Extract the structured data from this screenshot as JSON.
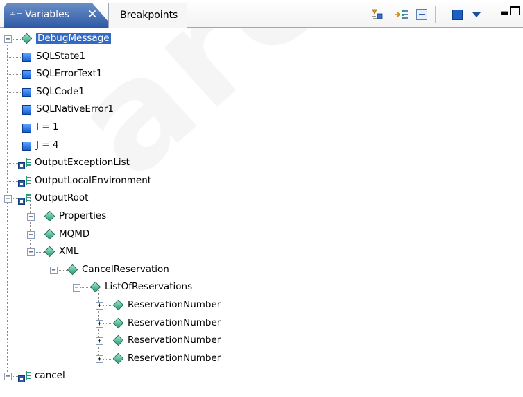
{
  "tabs": [
    {
      "label": "Variables",
      "active": true
    },
    {
      "label": "Breakpoints",
      "active": false
    }
  ],
  "toolbar": {
    "icons": [
      "show-type-names-icon",
      "step-filter-icon",
      "collapse-all-icon",
      "view-menu-square-icon",
      "view-menu-dropdown-icon"
    ]
  },
  "watermark": "archived",
  "tree": {
    "rows": [
      {
        "label": "DebugMessage",
        "level": 0,
        "icon": "diamond",
        "expander": "+",
        "selected": true
      },
      {
        "label": "SQLState1",
        "level": 0,
        "icon": "square",
        "expander": ""
      },
      {
        "label": "SQLErrorText1",
        "level": 0,
        "icon": "square",
        "expander": ""
      },
      {
        "label": "SQLCode1",
        "level": 0,
        "icon": "square",
        "expander": ""
      },
      {
        "label": "SQLNativeError1",
        "level": 0,
        "icon": "square",
        "expander": ""
      },
      {
        "label": "I = 1",
        "level": 0,
        "icon": "square",
        "expander": ""
      },
      {
        "label": "J = 4",
        "level": 0,
        "icon": "square",
        "expander": ""
      },
      {
        "label": "OutputExceptionList",
        "level": 0,
        "icon": "struct",
        "expander": ""
      },
      {
        "label": "OutputLocalEnvironment",
        "level": 0,
        "icon": "struct",
        "expander": ""
      },
      {
        "label": "OutputRoot",
        "level": 0,
        "icon": "struct",
        "expander": "−"
      },
      {
        "label": "Properties",
        "level": 1,
        "icon": "diamond",
        "expander": "+"
      },
      {
        "label": "MQMD",
        "level": 1,
        "icon": "diamond",
        "expander": "+"
      },
      {
        "label": "XML",
        "level": 1,
        "icon": "diamond",
        "expander": "−"
      },
      {
        "label": "CancelReservation",
        "level": 2,
        "icon": "diamond",
        "expander": "−"
      },
      {
        "label": "ListOfReservations",
        "level": 3,
        "icon": "diamond",
        "expander": "−"
      },
      {
        "label": "ReservationNumber",
        "level": 4,
        "icon": "diamond",
        "expander": "+"
      },
      {
        "label": "ReservationNumber",
        "level": 4,
        "icon": "diamond",
        "expander": "+"
      },
      {
        "label": "ReservationNumber",
        "level": 4,
        "icon": "diamond",
        "expander": "+"
      },
      {
        "label": "ReservationNumber",
        "level": 4,
        "icon": "diamond",
        "expander": "+"
      },
      {
        "label": "cancel",
        "level": 0,
        "icon": "struct",
        "expander": "+"
      }
    ]
  },
  "colors": {
    "selection": "#316ac5",
    "tab_active": "#2e5aa6",
    "diamond": "#2e9a78",
    "square": "#1560d8"
  }
}
